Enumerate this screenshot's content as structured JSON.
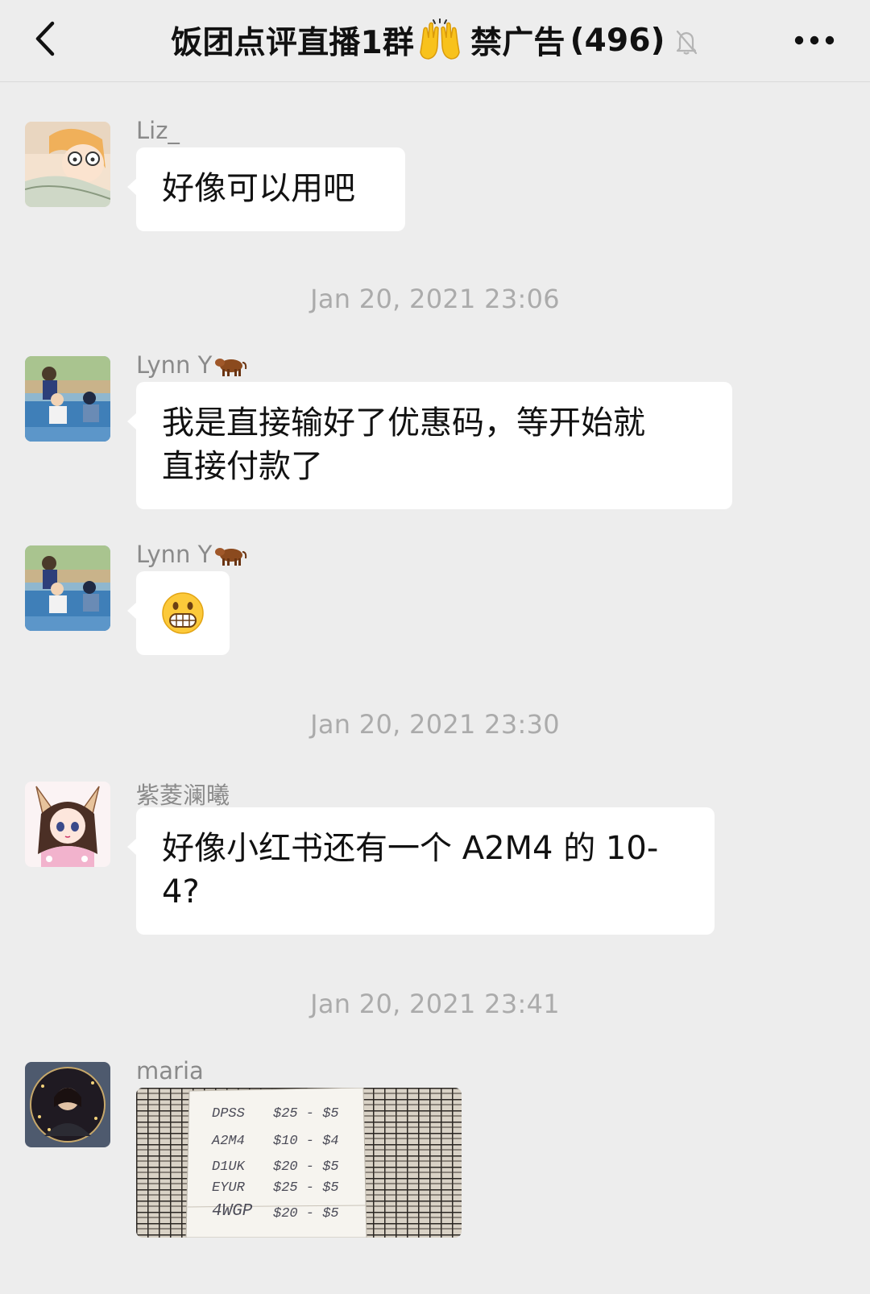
{
  "header": {
    "back_icon": "chevron-left-icon",
    "group_name": "饭团点评直播1群",
    "raised_hands_icon": "raised-hands-emoji",
    "group_suffix": "禁广告",
    "member_count": "(496)",
    "mute_icon": "bell-muted-icon",
    "more_icon": "more-dots-icon"
  },
  "messages": [
    {
      "type": "text",
      "sender": "Liz_",
      "text": "好像可以用吧",
      "avatar": "cartoon-avatar"
    },
    {
      "type": "timestamp",
      "text": "Jan 20, 2021 23:06"
    },
    {
      "type": "text",
      "sender": "Lynn Y",
      "sender_icon": "ox-emoji",
      "text": "我是直接输好了优惠码，等开始就直接付款了",
      "line1": "我是直接输好了优惠码，等开始就",
      "line2": "直接付款了",
      "avatar": "photo-avatar"
    },
    {
      "type": "emoji",
      "sender": "Lynn Y",
      "sender_icon": "ox-emoji",
      "emoji": "grimacing-face-emoji",
      "avatar": "photo-avatar"
    },
    {
      "type": "timestamp",
      "text": "Jan 20, 2021 23:30"
    },
    {
      "type": "text",
      "sender": "紫菱澜曦",
      "text": "好像小红书还有一个 A2M4 的 10-4?",
      "line1": "好像小红书还有一个 A2M4 的 10-",
      "line2": "4?",
      "avatar": "anime-fox-girl-avatar"
    },
    {
      "type": "timestamp",
      "text": "Jan 20, 2021 23:41"
    },
    {
      "type": "image",
      "sender": "maria",
      "avatar": "portrait-avatar",
      "image_desc": "handwritten-code-note-photo",
      "note_lines": [
        {
          "code": "DPSS",
          "amount": "$25 - $5"
        },
        {
          "code": "A2M4",
          "amount": "$10 - $4"
        },
        {
          "code": "D1UK",
          "amount": "$20 - $5"
        },
        {
          "code": "EYUR",
          "amount": "$25 - $5"
        },
        {
          "code": "4WGP",
          "amount": "$20 - $5"
        }
      ]
    }
  ],
  "colors": {
    "background": "#ededed",
    "bubble": "#ffffff",
    "timestamp": "#ababab",
    "sender": "#8a8a8a"
  }
}
